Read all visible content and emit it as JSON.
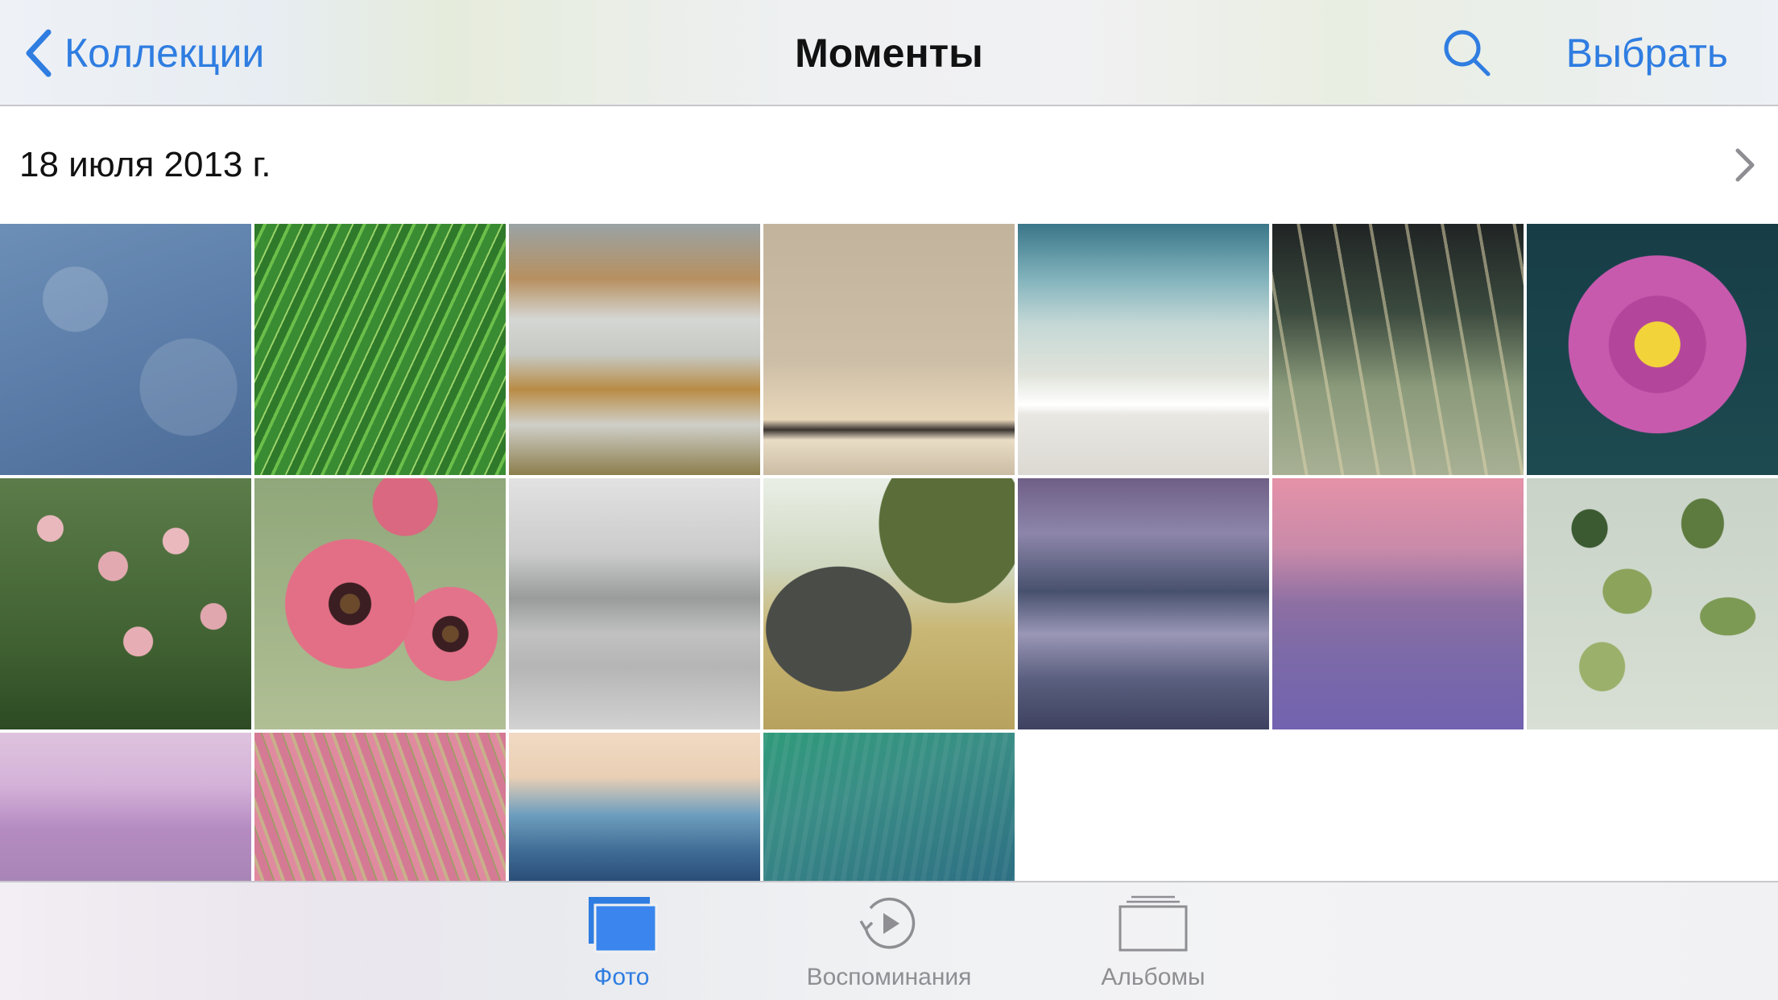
{
  "nav": {
    "back_label": "Коллекции",
    "title": "Моменты",
    "select_label": "Выбрать",
    "accent_color": "#2f7de1"
  },
  "moment": {
    "date": "18 июля 2013 г."
  },
  "photos": [
    {
      "subject": "blue-fern-pattern"
    },
    {
      "subject": "green-grass-dew"
    },
    {
      "subject": "misty-autumn-hills"
    },
    {
      "subject": "flamingos-at-dawn"
    },
    {
      "subject": "ocean-shoreline"
    },
    {
      "subject": "grass-seed-heads"
    },
    {
      "subject": "pink-lotus-flower"
    },
    {
      "subject": "pink-bell-flowers"
    },
    {
      "subject": "pink-poppies"
    },
    {
      "subject": "foggy-lake"
    },
    {
      "subject": "elephant-savanna"
    },
    {
      "subject": "mountain-lake-reflection"
    },
    {
      "subject": "mount-fuji-pink-sky"
    },
    {
      "subject": "lily-pads"
    },
    {
      "subject": "purple-misty-forest"
    },
    {
      "subject": "pink-grass-motion"
    },
    {
      "subject": "ocean-wave"
    },
    {
      "subject": "green-wave-texture"
    }
  ],
  "tabs": [
    {
      "label": "Фото",
      "icon": "photos-icon",
      "active": true
    },
    {
      "label": "Воспоминания",
      "icon": "memories-icon",
      "active": false
    },
    {
      "label": "Альбомы",
      "icon": "albums-icon",
      "active": false
    }
  ]
}
